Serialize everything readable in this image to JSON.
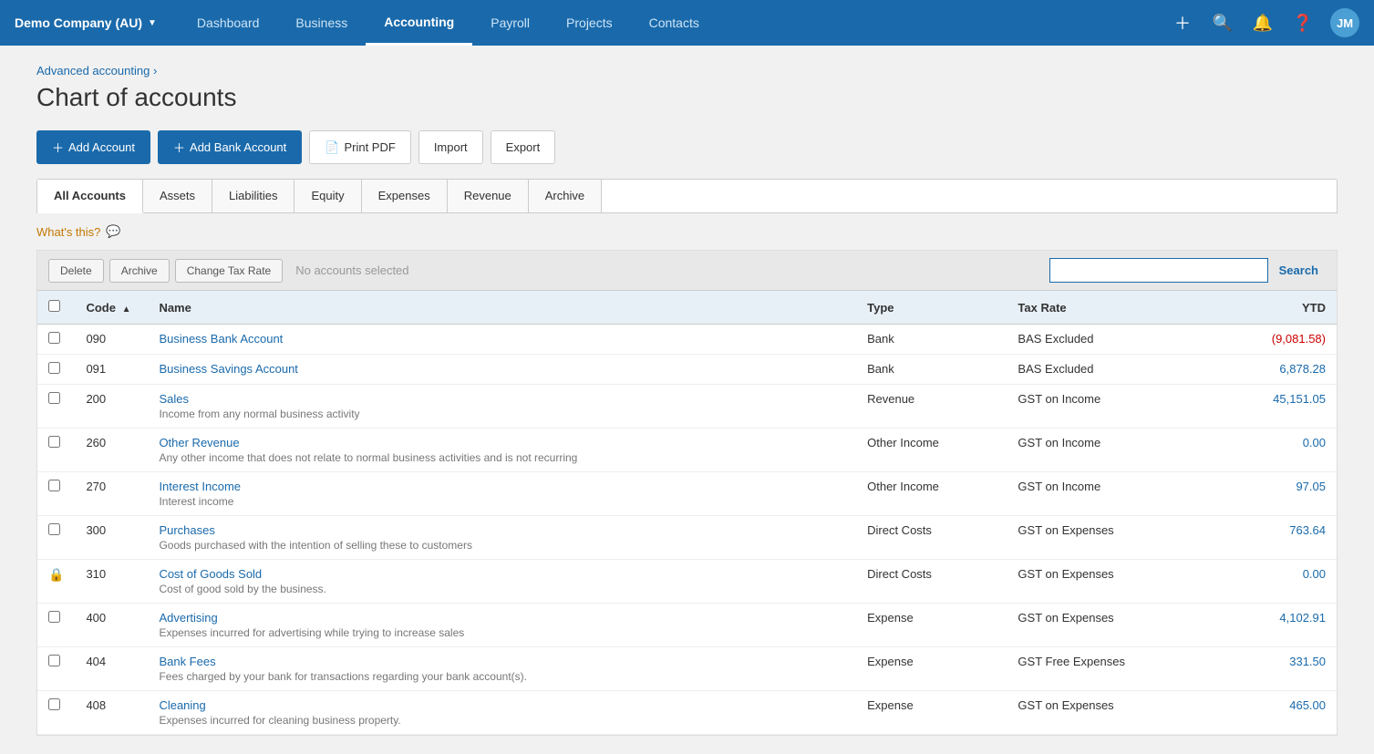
{
  "app": {
    "company": "Demo Company (AU)",
    "nav_items": [
      {
        "label": "Dashboard",
        "active": false
      },
      {
        "label": "Business",
        "active": false
      },
      {
        "label": "Accounting",
        "active": true
      },
      {
        "label": "Payroll",
        "active": false
      },
      {
        "label": "Projects",
        "active": false
      },
      {
        "label": "Contacts",
        "active": false
      }
    ],
    "avatar": "JM"
  },
  "breadcrumb": "Advanced accounting",
  "page_title": "Chart of accounts",
  "action_buttons": {
    "add_account": "Add Account",
    "add_bank_account": "Add Bank Account",
    "print_pdf": "Print PDF",
    "import": "Import",
    "export": "Export"
  },
  "tabs": [
    {
      "label": "All Accounts",
      "active": true
    },
    {
      "label": "Assets",
      "active": false
    },
    {
      "label": "Liabilities",
      "active": false
    },
    {
      "label": "Equity",
      "active": false
    },
    {
      "label": "Expenses",
      "active": false
    },
    {
      "label": "Revenue",
      "active": false
    },
    {
      "label": "Archive",
      "active": false
    }
  ],
  "whats_this": "What's this?",
  "toolbar": {
    "delete_label": "Delete",
    "archive_label": "Archive",
    "change_tax_rate_label": "Change Tax Rate",
    "no_selected": "No accounts selected",
    "search_placeholder": "",
    "search_label": "Search"
  },
  "table": {
    "headers": [
      {
        "label": "Code",
        "sortable": true,
        "sort_dir": "asc"
      },
      {
        "label": "Name"
      },
      {
        "label": "Type"
      },
      {
        "label": "Tax Rate"
      },
      {
        "label": "YTD",
        "align": "right"
      }
    ],
    "rows": [
      {
        "code": "090",
        "name": "Business Bank Account",
        "description": "",
        "type": "Bank",
        "tax_rate": "BAS Excluded",
        "ytd": "(9,081.58)",
        "ytd_class": "ytd-negative",
        "locked": false
      },
      {
        "code": "091",
        "name": "Business Savings Account",
        "description": "",
        "type": "Bank",
        "tax_rate": "BAS Excluded",
        "ytd": "6,878.28",
        "ytd_class": "ytd-positive",
        "locked": false
      },
      {
        "code": "200",
        "name": "Sales",
        "description": "Income from any normal business activity",
        "type": "Revenue",
        "tax_rate": "GST on Income",
        "ytd": "45,151.05",
        "ytd_class": "ytd-positive",
        "locked": false
      },
      {
        "code": "260",
        "name": "Other Revenue",
        "description": "Any other income that does not relate to normal business activities and is not recurring",
        "type": "Other Income",
        "tax_rate": "GST on Income",
        "ytd": "0.00",
        "ytd_class": "ytd-positive",
        "locked": false
      },
      {
        "code": "270",
        "name": "Interest Income",
        "description": "Interest income",
        "type": "Other Income",
        "tax_rate": "GST on Income",
        "ytd": "97.05",
        "ytd_class": "ytd-positive",
        "locked": false
      },
      {
        "code": "300",
        "name": "Purchases",
        "description": "Goods purchased with the intention of selling these to customers",
        "type": "Direct Costs",
        "tax_rate": "GST on Expenses",
        "ytd": "763.64",
        "ytd_class": "ytd-positive",
        "locked": false
      },
      {
        "code": "310",
        "name": "Cost of Goods Sold",
        "description": "Cost of good sold by the business.",
        "type": "Direct Costs",
        "tax_rate": "GST on Expenses",
        "ytd": "0.00",
        "ytd_class": "ytd-positive",
        "locked": true
      },
      {
        "code": "400",
        "name": "Advertising",
        "description": "Expenses incurred for advertising while trying to increase sales",
        "type": "Expense",
        "tax_rate": "GST on Expenses",
        "ytd": "4,102.91",
        "ytd_class": "ytd-positive",
        "locked": false
      },
      {
        "code": "404",
        "name": "Bank Fees",
        "description": "Fees charged by your bank for transactions regarding your bank account(s).",
        "type": "Expense",
        "tax_rate": "GST Free Expenses",
        "ytd": "331.50",
        "ytd_class": "ytd-positive",
        "locked": false
      },
      {
        "code": "408",
        "name": "Cleaning",
        "description": "Expenses incurred for cleaning business property.",
        "type": "Expense",
        "tax_rate": "GST on Expenses",
        "ytd": "465.00",
        "ytd_class": "ytd-positive",
        "locked": false
      }
    ]
  }
}
